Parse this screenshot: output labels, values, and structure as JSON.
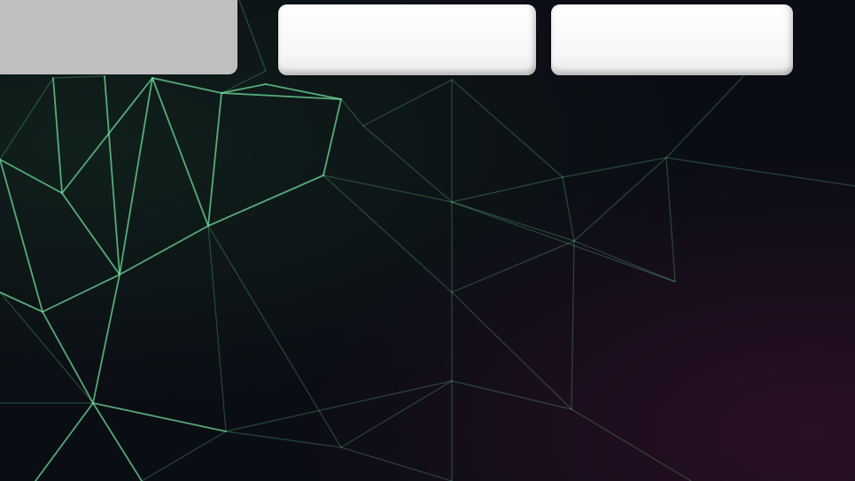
{
  "background": {
    "name": "network-mesh-wallpaper",
    "base_color": "#0b0d14",
    "line_color": "#6fdc9a",
    "glow_color": "#2a0f26"
  },
  "tiles": [
    {
      "id": "gray-panel",
      "label": "",
      "color": "#bfbfbf"
    },
    {
      "id": "white-button-1",
      "label": "",
      "color": "#f7f7f7"
    },
    {
      "id": "white-button-2",
      "label": "",
      "color": "#f7f7f7"
    }
  ]
}
